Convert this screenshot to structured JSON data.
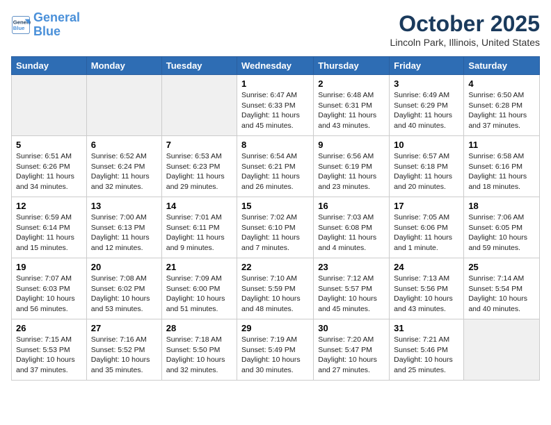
{
  "logo": {
    "line1": "General",
    "line2": "Blue"
  },
  "title": "October 2025",
  "location": "Lincoln Park, Illinois, United States",
  "days_of_week": [
    "Sunday",
    "Monday",
    "Tuesday",
    "Wednesday",
    "Thursday",
    "Friday",
    "Saturday"
  ],
  "weeks": [
    [
      {
        "day": "",
        "info": ""
      },
      {
        "day": "",
        "info": ""
      },
      {
        "day": "",
        "info": ""
      },
      {
        "day": "1",
        "info": "Sunrise: 6:47 AM\nSunset: 6:33 PM\nDaylight: 11 hours\nand 45 minutes."
      },
      {
        "day": "2",
        "info": "Sunrise: 6:48 AM\nSunset: 6:31 PM\nDaylight: 11 hours\nand 43 minutes."
      },
      {
        "day": "3",
        "info": "Sunrise: 6:49 AM\nSunset: 6:29 PM\nDaylight: 11 hours\nand 40 minutes."
      },
      {
        "day": "4",
        "info": "Sunrise: 6:50 AM\nSunset: 6:28 PM\nDaylight: 11 hours\nand 37 minutes."
      }
    ],
    [
      {
        "day": "5",
        "info": "Sunrise: 6:51 AM\nSunset: 6:26 PM\nDaylight: 11 hours\nand 34 minutes."
      },
      {
        "day": "6",
        "info": "Sunrise: 6:52 AM\nSunset: 6:24 PM\nDaylight: 11 hours\nand 32 minutes."
      },
      {
        "day": "7",
        "info": "Sunrise: 6:53 AM\nSunset: 6:23 PM\nDaylight: 11 hours\nand 29 minutes."
      },
      {
        "day": "8",
        "info": "Sunrise: 6:54 AM\nSunset: 6:21 PM\nDaylight: 11 hours\nand 26 minutes."
      },
      {
        "day": "9",
        "info": "Sunrise: 6:56 AM\nSunset: 6:19 PM\nDaylight: 11 hours\nand 23 minutes."
      },
      {
        "day": "10",
        "info": "Sunrise: 6:57 AM\nSunset: 6:18 PM\nDaylight: 11 hours\nand 20 minutes."
      },
      {
        "day": "11",
        "info": "Sunrise: 6:58 AM\nSunset: 6:16 PM\nDaylight: 11 hours\nand 18 minutes."
      }
    ],
    [
      {
        "day": "12",
        "info": "Sunrise: 6:59 AM\nSunset: 6:14 PM\nDaylight: 11 hours\nand 15 minutes."
      },
      {
        "day": "13",
        "info": "Sunrise: 7:00 AM\nSunset: 6:13 PM\nDaylight: 11 hours\nand 12 minutes."
      },
      {
        "day": "14",
        "info": "Sunrise: 7:01 AM\nSunset: 6:11 PM\nDaylight: 11 hours\nand 9 minutes."
      },
      {
        "day": "15",
        "info": "Sunrise: 7:02 AM\nSunset: 6:10 PM\nDaylight: 11 hours\nand 7 minutes."
      },
      {
        "day": "16",
        "info": "Sunrise: 7:03 AM\nSunset: 6:08 PM\nDaylight: 11 hours\nand 4 minutes."
      },
      {
        "day": "17",
        "info": "Sunrise: 7:05 AM\nSunset: 6:06 PM\nDaylight: 11 hours\nand 1 minute."
      },
      {
        "day": "18",
        "info": "Sunrise: 7:06 AM\nSunset: 6:05 PM\nDaylight: 10 hours\nand 59 minutes."
      }
    ],
    [
      {
        "day": "19",
        "info": "Sunrise: 7:07 AM\nSunset: 6:03 PM\nDaylight: 10 hours\nand 56 minutes."
      },
      {
        "day": "20",
        "info": "Sunrise: 7:08 AM\nSunset: 6:02 PM\nDaylight: 10 hours\nand 53 minutes."
      },
      {
        "day": "21",
        "info": "Sunrise: 7:09 AM\nSunset: 6:00 PM\nDaylight: 10 hours\nand 51 minutes."
      },
      {
        "day": "22",
        "info": "Sunrise: 7:10 AM\nSunset: 5:59 PM\nDaylight: 10 hours\nand 48 minutes."
      },
      {
        "day": "23",
        "info": "Sunrise: 7:12 AM\nSunset: 5:57 PM\nDaylight: 10 hours\nand 45 minutes."
      },
      {
        "day": "24",
        "info": "Sunrise: 7:13 AM\nSunset: 5:56 PM\nDaylight: 10 hours\nand 43 minutes."
      },
      {
        "day": "25",
        "info": "Sunrise: 7:14 AM\nSunset: 5:54 PM\nDaylight: 10 hours\nand 40 minutes."
      }
    ],
    [
      {
        "day": "26",
        "info": "Sunrise: 7:15 AM\nSunset: 5:53 PM\nDaylight: 10 hours\nand 37 minutes."
      },
      {
        "day": "27",
        "info": "Sunrise: 7:16 AM\nSunset: 5:52 PM\nDaylight: 10 hours\nand 35 minutes."
      },
      {
        "day": "28",
        "info": "Sunrise: 7:18 AM\nSunset: 5:50 PM\nDaylight: 10 hours\nand 32 minutes."
      },
      {
        "day": "29",
        "info": "Sunrise: 7:19 AM\nSunset: 5:49 PM\nDaylight: 10 hours\nand 30 minutes."
      },
      {
        "day": "30",
        "info": "Sunrise: 7:20 AM\nSunset: 5:47 PM\nDaylight: 10 hours\nand 27 minutes."
      },
      {
        "day": "31",
        "info": "Sunrise: 7:21 AM\nSunset: 5:46 PM\nDaylight: 10 hours\nand 25 minutes."
      },
      {
        "day": "",
        "info": ""
      }
    ]
  ]
}
